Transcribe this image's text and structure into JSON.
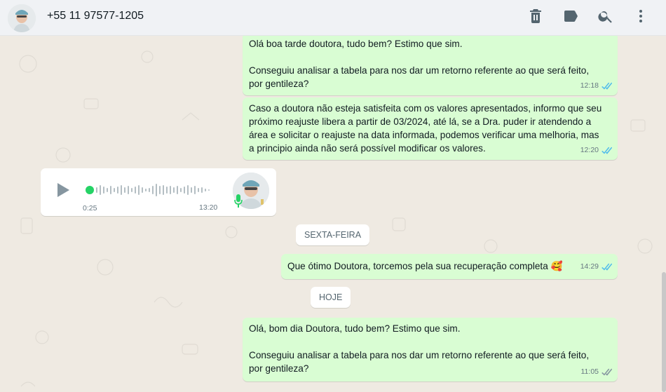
{
  "header": {
    "contact_name": "+55 11 97577-1205",
    "icons": [
      "trash-icon",
      "label-icon",
      "search-icon",
      "menu-icon"
    ]
  },
  "messages": [
    {
      "text": "Olá boa tarde doutora, tudo bem? Estimo que sim.\n\nConseguiu analisar a tabela para nos dar um retorno referente ao que será feito,\npor gentileza?",
      "time": "12:18"
    },
    {
      "text": "Caso a doutora não esteja satisfeita com os valores apresentados, informo que seu\npróximo reajuste libera a partir de 03/2024, até lá, se a Dra. puder ir atendendo a\nárea e solicitar o reajuste na data informada, podemos verificar uma melhoria, mas\na principio ainda não será possível modificar os valores.",
      "time": "12:20"
    },
    {
      "text": "Que ótimo Doutora, torcemos pela sua recuperação completa 🥰",
      "time": "14:29"
    },
    {
      "text": "Olá, bom dia Doutora, tudo bem? Estimo que sim.\n\nConseguiu analisar a tabela para nos dar um retorno referente ao que será feito,\npor gentileza?",
      "time": "11:05"
    }
  ],
  "audio": {
    "duration": "0:25",
    "time": "13:20"
  },
  "dates": {
    "friday": "SEXTA-FEIRA",
    "today": "HOJE"
  },
  "colors": {
    "outgoing_bubble": "#d9fdd3",
    "read_ticks": "#53bdeb",
    "background": "#efeae2"
  }
}
